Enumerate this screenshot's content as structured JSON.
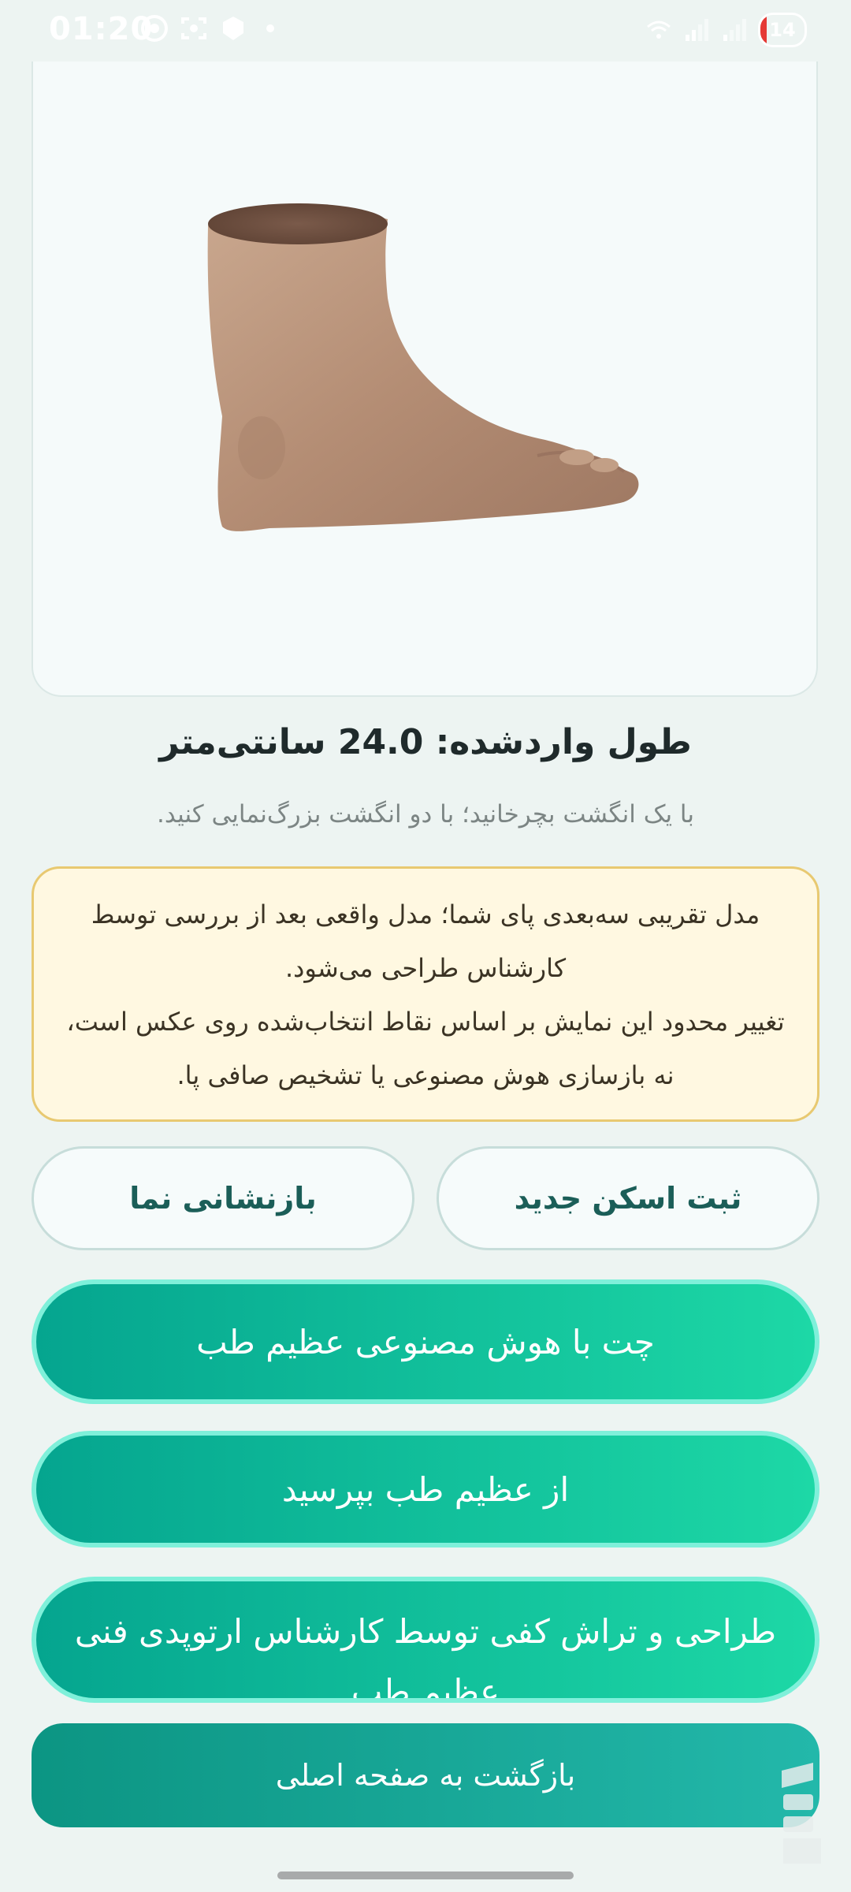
{
  "status_bar": {
    "time": "01:20",
    "battery": "14"
  },
  "model_viewer": {
    "object": "foot-3d-model"
  },
  "length_title": "طول واردشده: 24.0 سانتی‌متر",
  "hint": "با یک انگشت بچرخانید؛ با دو انگشت بزرگ‌نمایی کنید.",
  "notice": {
    "line1": "مدل تقریبی سه‌بعدی پای شما؛ مدل واقعی بعد از بررسی توسط کارشناس طراحی می‌شود.",
    "line2": "تغییر محدود این نمایش بر اساس نقاط انتخاب‌شده روی عکس است، نه بازسازی هوش مصنوعی یا تشخیص صافی پا."
  },
  "buttons": {
    "register_scan": "ثبت اسکن جدید",
    "reset_view": "بازنشانی نما",
    "chat_ai": "چت با هوش مصنوعی عظیم طب",
    "ask": "از عظیم طب بپرسید",
    "design": "طراحی و تراش کفی توسط کارشناس ارتوپدی فنی عظیم طب",
    "back_home": "بازگشت به صفحه اصلی"
  },
  "colors": {
    "primary": "#05a58f",
    "primary_light": "#1dd8a6",
    "notice_bg": "#fff8e1",
    "notice_border": "#e8c971"
  }
}
